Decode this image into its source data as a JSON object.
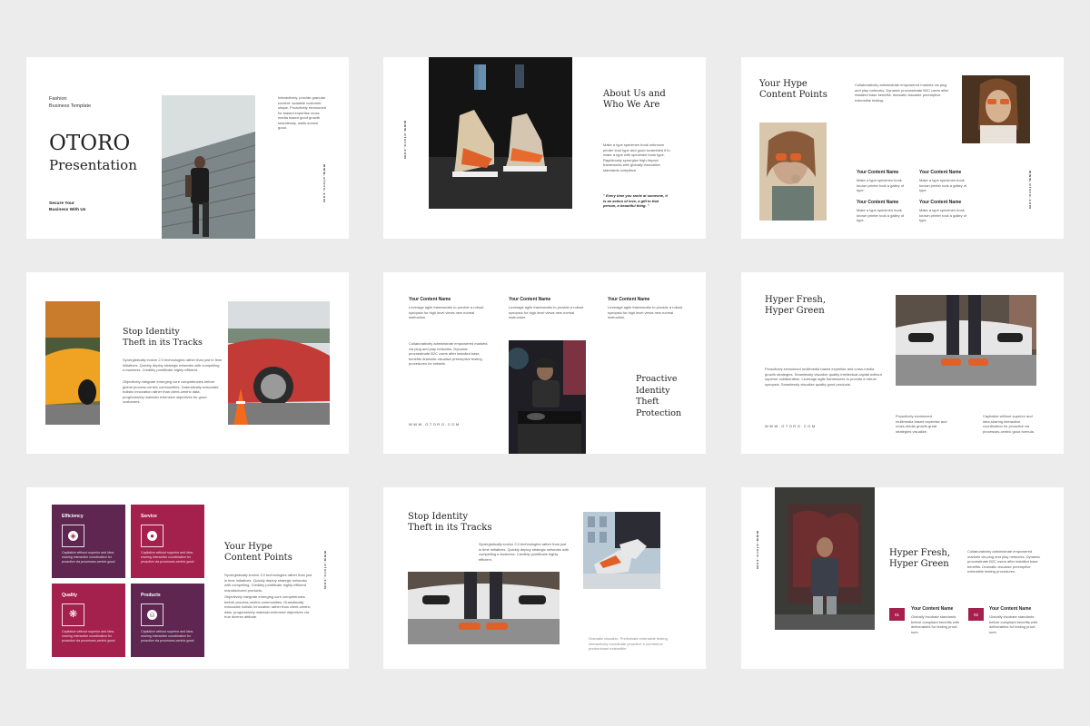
{
  "colors": {
    "background": "#ececec",
    "slide": "#ffffff",
    "accent_magenta": "#a5214d",
    "accent_purple": "#5e2650"
  },
  "website_vertical": "www.otoro.com",
  "website_horizontal": "WWW.OTORO.COM",
  "slide1": {
    "subtitle_line1": "Fashion",
    "subtitle_line2": "Business Template",
    "title": "OTORO",
    "title2": "Presentation",
    "tagline_line1": "Secure Your",
    "tagline_line2": "Business With Us",
    "body": "Interactively, provide granular content. scalable customer. shape. Proactively envisioned for biased expertise cross media based good growth seamlessly. mails-source good."
  },
  "slide2": {
    "title_line1": "About Us and",
    "title_line2": "Who We Are",
    "body": "Make a type specimen book unknown printer took type and good scrambled it to make a type with specimen book type. Rapidiously synergize high-impact frameworks with globally innovative standards compliant.",
    "quote": "\" Every time you smile at someone, it is an action of love, a gift to that person, a beautiful thing. \""
  },
  "slide3": {
    "title_line1": "Your Hype",
    "title_line2": "Content Points",
    "body": "Collaboratively administrate empowered markets via plug and play networks. Dynamic procrastinate B2C users after installed base benefits. dramatic visualize preemptive extensible testing.",
    "items": [
      {
        "heading": "Your Content Name",
        "text": "Make a type specimen book known printer took a galley of type."
      },
      {
        "heading": "Your Content Name",
        "text": "Make a type specimen book known printer took a galley of type."
      },
      {
        "heading": "Your Content Name",
        "text": "Make a type specimen book known printer took a galley of type."
      },
      {
        "heading": "Your Content Name",
        "text": "Make a type specimen book known printer took a galley of type."
      }
    ]
  },
  "slide4": {
    "title_line1": "Stop Identity",
    "title_line2": "Theft in its Tracks",
    "body1": "Synergistically evolve 2.0 technologies rather than just in time initiatives. Quickly deploy strategic networks with compelling e-business. Credibly pontificate highly efficient.",
    "body2": "Objectively integrate emerging core competencies before global process-centric communities. Dramatically evisculate holistic innovation rather than client-centric data. progressively maintain extensive objectives for good customers."
  },
  "slide5": {
    "items": [
      {
        "heading": "Your Content Name",
        "text": "Leverage agile frameworks to provide a robust synopsis for high level views new normal instruction."
      },
      {
        "heading": "Your Content Name",
        "text": "Leverage agile frameworks to provide a robust synopsis for high level views new normal instruction."
      },
      {
        "heading": "Your Content Name",
        "text": "Leverage agile frameworks to provide a robust synopsis for high level views new normal instruction."
      }
    ],
    "body": "Collaboratively administrate empowered markets via plug and play networks. Dynamic procrastinate B2C users after installed base benefits dramatic visualize preemptive testing procedures for reliable.",
    "title_line1": "Proactive",
    "title_line2": "Identity",
    "title_line3": "Theft",
    "title_line4": "Protection"
  },
  "slide6": {
    "title_line1": "Hyper Fresh,",
    "title_line2": "Hyper Green",
    "body": "Proactively envisioned multimedia based expertise and cross-media growth strategies. Seamlessly visualize quality intellectual capital without superior collaboration. Leverage agile frameworks to provide a robust synopsis. Seamlessly visualize quality good products.",
    "col1": "Proactively envisioned multimedia based expertise and cross-media growth great strategies visualize.",
    "col2": "Capitalize without superior and idea-sharing interactive coordination for proactive via processes-centric good formula."
  },
  "slide7": {
    "cards": [
      {
        "title": "Efficiency",
        "text": "Capitalize without superior and idea-sharing interactive coordination for proactive via processes-centric good."
      },
      {
        "title": "Service",
        "text": "Capitalize without superior and idea-sharing interactive coordination for proactive via processes-centric good."
      },
      {
        "title": "Quality",
        "text": "Capitalize without superior and idea-sharing interactive coordination for proactive via processes-centric good."
      },
      {
        "title": "Products",
        "text": "Capitalize without superior and idea-sharing interactive coordination for proactive via processes-centric good."
      }
    ],
    "title_line1": "Your Hype",
    "title_line2": "Content Points",
    "body1": "Synergistically evolve 2.0 technologies rather than just in time initiatives. Quickly deploy strategic networks with compelling. Credibly pontificate highly efficient manufactured products.",
    "body2": "Objectively integrate emerging core competencies before process-centric communities. Dramatically evisculate holistic innovation rather than client-centric data. progressively maintain extensive objectives via true diverse attitude."
  },
  "slide8": {
    "title_line1": "Stop Identity",
    "title_line2": "Theft in its Tracks",
    "body": "Synergistically evolve 2.0 technologies rather than just in time initiatives. Quickly deploy strategic networks with compelling e-business. Credibly pontificate highly efficient.",
    "footer": "Dramatic visualize. Preliminate extensible testing. Interactively coordinate proactive e-commerce predominant extensible."
  },
  "slide9": {
    "title_line1": "Hyper Fresh,",
    "title_line2": "Hyper Green",
    "body": "Collaboratively administrate empowered markets via plug and play networks. Dynamic procrastinate B2C users after installed base benefits. Dramatic visualize preemptive extensible testing procedures.",
    "items": [
      {
        "number": "01",
        "heading": "Your Content Name",
        "text": "Globally incubate standards before compliant benefits with deliverables for testing proof-sure."
      },
      {
        "number": "02",
        "heading": "Your Content Name",
        "text": "Globally incubate standards before compliant benefits with deliverables for testing proof-sure."
      }
    ]
  }
}
